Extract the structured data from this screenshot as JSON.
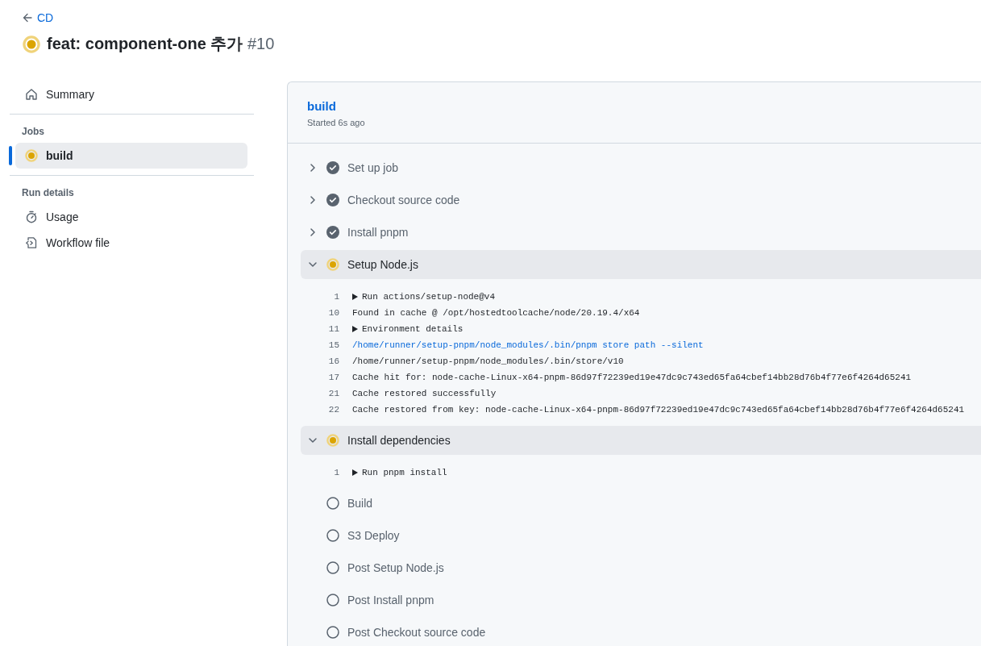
{
  "back_link": "CD",
  "run": {
    "kind": "running",
    "title": "feat: component-one 추가",
    "number": "#10"
  },
  "sidebar": {
    "summary": {
      "kind": "home",
      "label": "Summary",
      "selected": false
    },
    "sections": [
      {
        "heading": "Jobs",
        "items": [
          {
            "kind": "running",
            "label": "build",
            "selected": true
          }
        ]
      },
      {
        "heading": "Run details",
        "items": [
          {
            "kind": "usage",
            "label": "Usage",
            "selected": false
          },
          {
            "kind": "workflow",
            "label": "Workflow file",
            "selected": false
          }
        ]
      }
    ]
  },
  "job": {
    "name": "build",
    "started": "Started 6s ago",
    "steps": [
      {
        "name": "Set up job",
        "kind": "success",
        "expanded": false
      },
      {
        "name": "Checkout source code",
        "kind": "success",
        "expanded": false
      },
      {
        "name": "Install pnpm",
        "kind": "success",
        "expanded": false
      },
      {
        "name": "Setup Node.js",
        "kind": "running",
        "expanded": true,
        "log": [
          {
            "line": "1",
            "kind": "group",
            "text": "Run actions/setup-node@v4"
          },
          {
            "line": "10",
            "kind": "plain",
            "text": "Found in cache @ /opt/hostedtoolcache/node/20.19.4/x64"
          },
          {
            "line": "11",
            "kind": "group",
            "text": "Environment details"
          },
          {
            "line": "15",
            "kind": "command",
            "text": "/home/runner/setup-pnpm/node_modules/.bin/pnpm store path --silent"
          },
          {
            "line": "16",
            "kind": "plain",
            "text": "/home/runner/setup-pnpm/node_modules/.bin/store/v10"
          },
          {
            "line": "17",
            "kind": "plain",
            "text": "Cache hit for: node-cache-Linux-x64-pnpm-86d97f72239ed19e47dc9c743ed65fa64cbef14bb28d76b4f77e6f4264d65241"
          },
          {
            "line": "21",
            "kind": "plain",
            "text": "Cache restored successfully"
          },
          {
            "line": "22",
            "kind": "plain",
            "text": "Cache restored from key: node-cache-Linux-x64-pnpm-86d97f72239ed19e47dc9c743ed65fa64cbef14bb28d76b4f77e6f4264d65241"
          }
        ]
      },
      {
        "name": "Install dependencies",
        "kind": "running",
        "expanded": true,
        "log": [
          {
            "line": "1",
            "kind": "group",
            "text": "Run pnpm install"
          }
        ]
      },
      {
        "name": "Build",
        "kind": "pending"
      },
      {
        "name": "S3 Deploy",
        "kind": "pending"
      },
      {
        "name": "Post Setup Node.js",
        "kind": "pending"
      },
      {
        "name": "Post Install pnpm",
        "kind": "pending"
      },
      {
        "name": "Post Checkout source code",
        "kind": "pending"
      }
    ]
  }
}
